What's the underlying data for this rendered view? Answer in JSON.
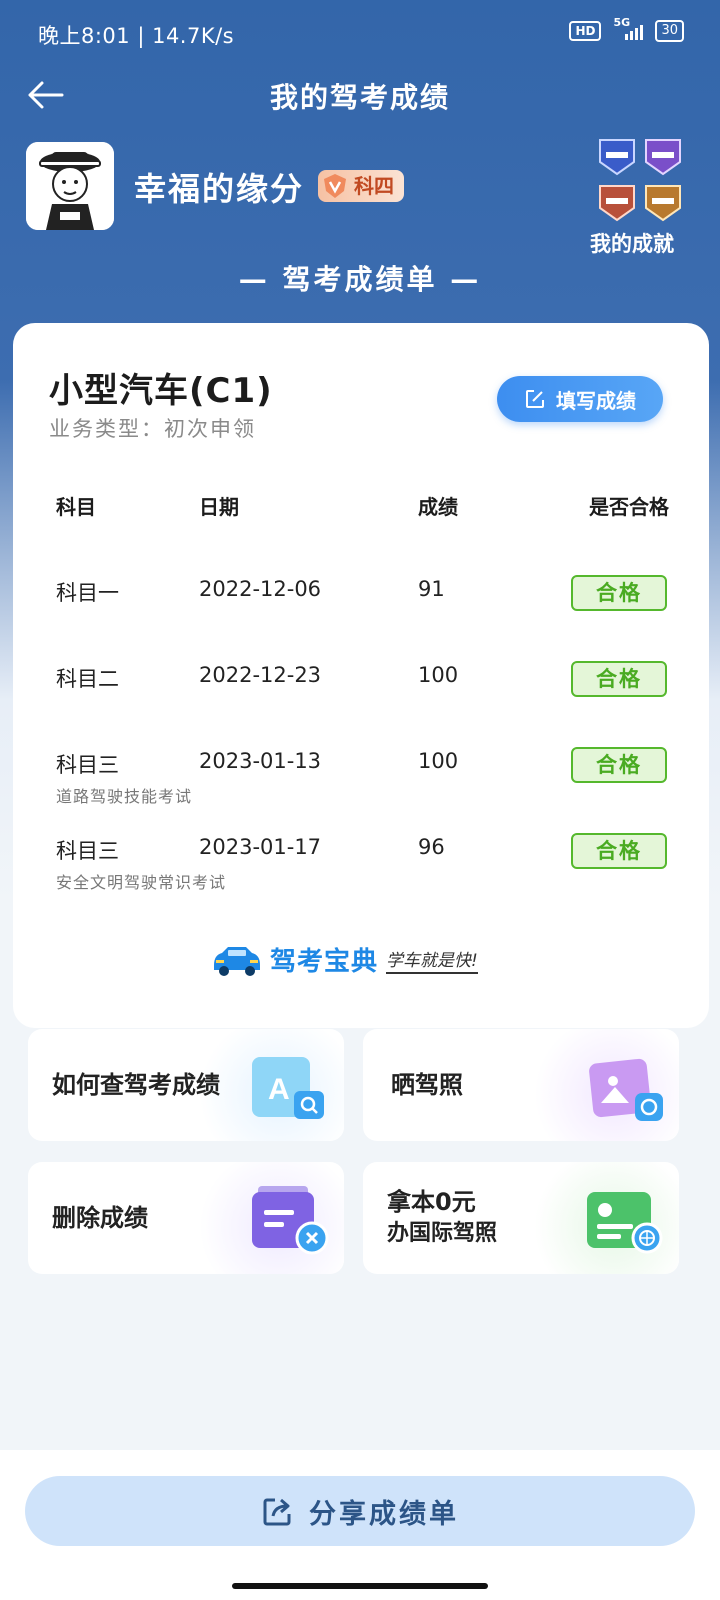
{
  "status_bar": {
    "text": "晚上8:01 | 14.7K/s",
    "hd": "HD",
    "network": "5G",
    "battery": "30"
  },
  "nav": {
    "title": "我的驾考成绩",
    "back_icon": "arrow-left-icon"
  },
  "profile": {
    "username": "幸福的缘分",
    "level_label": "科四",
    "level_icon": "v-shield-icon"
  },
  "achievements": {
    "label": "我的成就",
    "medals": [
      "medal-blue-icon",
      "medal-purple-icon",
      "medal-red-icon",
      "medal-gold-icon"
    ]
  },
  "report": {
    "heading": "— 驾考成绩单 —"
  },
  "card": {
    "vehicle_type": "小型汽车(C1)",
    "business_type": "业务类型：初次申领",
    "fill_button": "填写成绩",
    "columns": {
      "subject": "科目",
      "date": "日期",
      "score": "成绩",
      "passed": "是否合格"
    },
    "rows": [
      {
        "subject": "科目一",
        "date": "2022-12-06",
        "score": "91",
        "passed": "合格",
        "note": ""
      },
      {
        "subject": "科目二",
        "date": "2022-12-23",
        "score": "100",
        "passed": "合格",
        "note": ""
      },
      {
        "subject": "科目三",
        "date": "2023-01-13",
        "score": "100",
        "passed": "合格",
        "note": "道路驾驶技能考试"
      },
      {
        "subject": "科目三",
        "date": "2023-01-17",
        "score": "96",
        "passed": "合格",
        "note": "安全文明驾驶常识考试"
      }
    ],
    "brand_name": "驾考宝典",
    "brand_slogan": "学车就是快!"
  },
  "tiles": [
    {
      "label": "如何查驾考成绩",
      "icon": "search-doc-icon"
    },
    {
      "label": "晒驾照",
      "icon": "photo-share-icon"
    },
    {
      "label": "删除成绩",
      "icon": "delete-record-icon"
    },
    {
      "label_line1": "拿本0元",
      "label_line2": "办国际驾照",
      "icon": "international-license-icon"
    }
  ],
  "share": {
    "label": "分享成绩单",
    "icon": "share-icon"
  },
  "colors": {
    "header_blue": "#3366aa",
    "pass_green": "#4aab22",
    "accent_blue": "#3d8ef0",
    "share_bg": "#cfe3fa"
  }
}
